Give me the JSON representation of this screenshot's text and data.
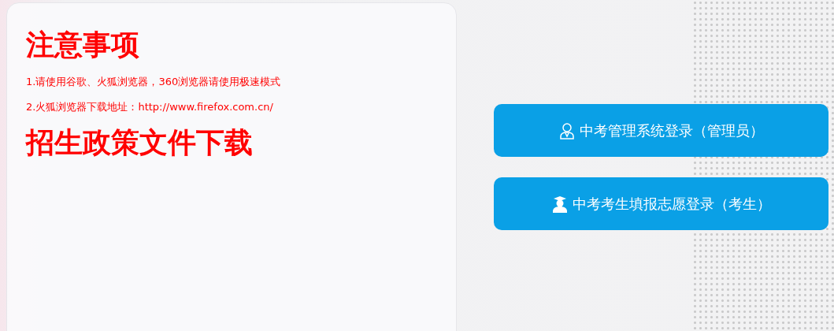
{
  "notice": {
    "title": "注意事项",
    "items": [
      "1.请使用谷歌、火狐浏览器，360浏览器请使用极速模式",
      "2.火狐浏览器下载地址：http://www.firefox.com.cn/"
    ]
  },
  "downloads": {
    "title": "招生政策文件下载"
  },
  "logins": [
    {
      "kind": "admin",
      "label": "中考管理系统登录（管理员）"
    },
    {
      "kind": "student",
      "label": "中考考生填报志愿登录（考生）"
    }
  ]
}
